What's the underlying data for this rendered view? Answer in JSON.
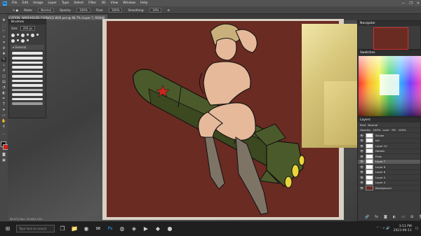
{
  "app": {
    "logo": "Ps",
    "menu": [
      "File",
      "Edit",
      "Image",
      "Layer",
      "Type",
      "Select",
      "Filter",
      "3D",
      "View",
      "Window",
      "Help"
    ],
    "window_controls": [
      "—",
      "❐",
      "✕"
    ]
  },
  "options_bar": {
    "mode_label": "Mode:",
    "mode_value": "Normal",
    "opacity_label": "Opacity:",
    "opacity_value": "100%",
    "flow_label": "Flow:",
    "flow_value": "100%",
    "smoothing_label": "Smoothing:",
    "smoothing_value": "10%"
  },
  "document": {
    "tab_title": "LOCATION: WAREHOUSE FURNACE W00.psd @ 66.7% (Layer 7, RGB/8)"
  },
  "brushes_panel": {
    "title": "Brushes",
    "size_label": "Size:",
    "size_value": "200 px",
    "folder_label": "General",
    "tip_count": 10,
    "stroke_count": 12
  },
  "navigator_panel": {
    "title": "Navigator"
  },
  "swatches_panel": {
    "title": "Swatches"
  },
  "layers_panel": {
    "title": "Layers",
    "kind_label": "Kind",
    "blend_value": "Normal",
    "opacity_label": "Opacity:",
    "opacity_value": "100%",
    "lock_label": "Lock:",
    "fill_label": "Fill:",
    "fill_value": "100%",
    "layers": [
      {
        "name": "Stroke"
      },
      {
        "name": "Ink"
      },
      {
        "name": "Layer 10"
      },
      {
        "name": "Details"
      },
      {
        "name": "Flats"
      },
      {
        "name": "Layer 7"
      },
      {
        "name": "Layer 8"
      },
      {
        "name": "Layer 6"
      },
      {
        "name": "Layer 5"
      },
      {
        "name": "Layer 4"
      },
      {
        "name": "Background"
      }
    ]
  },
  "status": {
    "zoom": "66.67%",
    "doc_size": "Doc: 29.2M/1.31G"
  },
  "taskbar": {
    "search_placeholder": "Type here to search",
    "time": "3:51 PM",
    "date": "2023-09-11"
  },
  "colors": {
    "canvas_red": "#6a2b22",
    "rocket_green": "#4b5a2a",
    "star_red": "#d0231e",
    "skin": "#e6b99a",
    "ui_panel": "#3c3c3c"
  }
}
